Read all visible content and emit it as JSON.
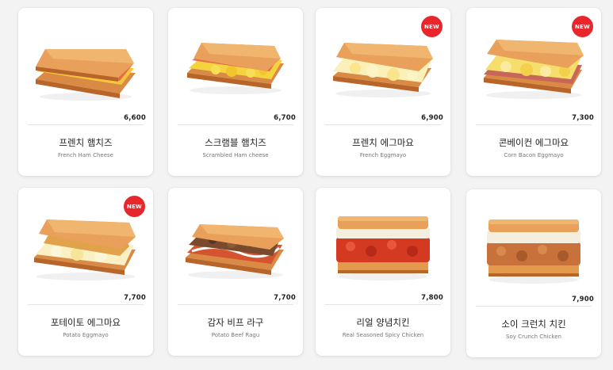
{
  "menu": {
    "items": [
      {
        "name_ko": "프렌치 햄치즈",
        "name_en": "French Ham Cheese",
        "price": "6,600",
        "badge": "",
        "filling": "ham-cheese"
      },
      {
        "name_ko": "스크램블 햄치즈",
        "name_en": "Scrambled Ham cheese",
        "price": "6,700",
        "badge": "",
        "filling": "scrambled"
      },
      {
        "name_ko": "프렌치 에그마요",
        "name_en": "French Eggmayo",
        "price": "6,900",
        "badge": "NEW",
        "filling": "eggmayo"
      },
      {
        "name_ko": "콘베이컨 에그마요",
        "name_en": "Corn Bacon Eggmayo",
        "price": "7,300",
        "badge": "NEW",
        "filling": "corn-bacon"
      },
      {
        "name_ko": "포테이토 에그마요",
        "name_en": "Potato Eggmayo",
        "price": "7,700",
        "badge": "NEW",
        "filling": "potato"
      },
      {
        "name_ko": "감자 비프 라구",
        "name_en": "Potato Beef Ragu",
        "price": "7,700",
        "badge": "",
        "filling": "beef"
      },
      {
        "name_ko": "리얼 양념치킨",
        "name_en": "Real Seasoned Spicy Chicken",
        "price": "7,800",
        "badge": "",
        "filling": "spicy-chicken"
      },
      {
        "name_ko": "소이 크런치 치킨",
        "name_en": "Soy Crunch Chicken",
        "price": "7,900",
        "badge": "",
        "filling": "soy-chicken"
      }
    ]
  },
  "colors": {
    "badge": "#e8262b",
    "bread": "#e39a4d",
    "crust": "#b8652a"
  }
}
